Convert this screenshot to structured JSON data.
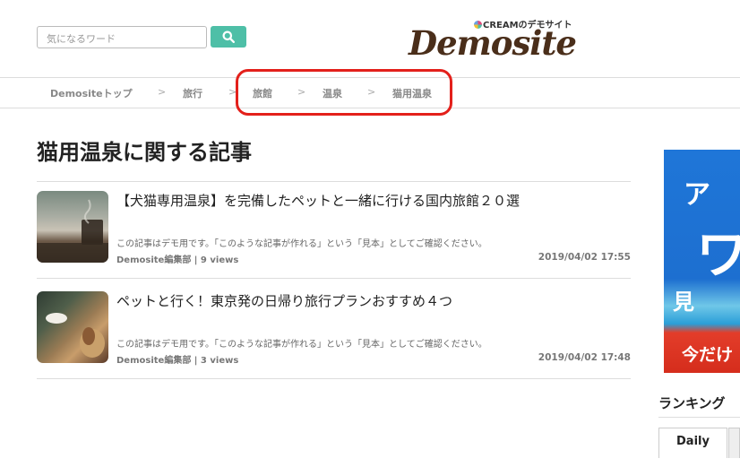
{
  "header": {
    "search_placeholder": "気になるワード",
    "logo_sub": "CREAMのデモサイト",
    "logo_main": "Demosite"
  },
  "breadcrumb": {
    "items": [
      "Demositeトップ",
      "旅行",
      "旅館",
      "温泉",
      "猫用温泉"
    ],
    "separator": ">"
  },
  "main": {
    "title": "猫用温泉に関する記事",
    "articles": [
      {
        "title": "【犬猫専用温泉】を完備したペットと一緒に行ける国内旅館２０選",
        "desc": "この記事はデモ用です。「このような記事が作れる」という「見本」としてご確認ください。",
        "meta": "Demosite編集部 | 9 views",
        "date": "2019/04/02 17:55"
      },
      {
        "title": "ペットと行く！東京発の日帰り旅行プランおすすめ４つ",
        "desc": "この記事はデモ用です。「このような記事が作れる」という「見本」としてご確認ください。",
        "meta": "Demosite編集部 | 3 views",
        "date": "2019/04/02 17:48"
      }
    ]
  },
  "sidebar": {
    "banner": [
      "ア",
      "ワ",
      "見",
      "今だけ"
    ],
    "ranking_title": "ランキング",
    "tab_daily": "Daily"
  },
  "colors": {
    "accent": "#4ebfa7",
    "highlight": "#e3201b",
    "logo": "#4a2e1a"
  }
}
